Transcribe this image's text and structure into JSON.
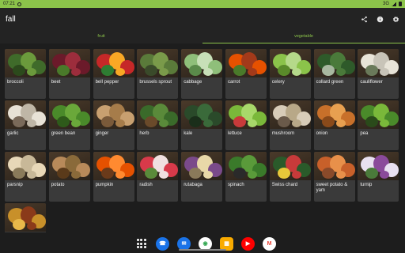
{
  "status": {
    "time": "07:21",
    "network": "3G"
  },
  "app": {
    "title": "fall"
  },
  "tabs": [
    {
      "label": "fruit",
      "active": false
    },
    {
      "label": "vegetable",
      "active": true
    }
  ],
  "colors": {
    "accent": "#8bc34a",
    "card": "#3a3a3a",
    "background": "#1d1d1d"
  },
  "items": [
    {
      "label": "broccoli",
      "colors": [
        "#3f6b2a",
        "#6b9a3c",
        "#2c4a1c"
      ]
    },
    {
      "label": "beet",
      "colors": [
        "#6b1a2a",
        "#9c2d3c",
        "#4a7a2a"
      ]
    },
    {
      "label": "bell pepper",
      "colors": [
        "#c62828",
        "#f9a825",
        "#2e7d32"
      ]
    },
    {
      "label": "brussels sprout",
      "colors": [
        "#5a7a3a",
        "#7a9a4a",
        "#3a4a2a"
      ]
    },
    {
      "label": "cabbage",
      "colors": [
        "#8fbf7a",
        "#c8e0b8",
        "#5a8a4a"
      ]
    },
    {
      "label": "carrot",
      "colors": [
        "#e65100",
        "#a33a1a",
        "#4a7a2a"
      ]
    },
    {
      "label": "celery",
      "colors": [
        "#8bc34a",
        "#b5d98a",
        "#5a8a2a"
      ]
    },
    {
      "label": "collard green",
      "colors": [
        "#2e5a2a",
        "#4a7a3a",
        "#a8b8a0"
      ]
    },
    {
      "label": "cauliflower",
      "colors": [
        "#e8e4d8",
        "#c8c4b8",
        "#6a7a5a"
      ]
    },
    {
      "label": "garlic",
      "colors": [
        "#e8e2d6",
        "#bfb6a6",
        "#7a6a5a"
      ]
    },
    {
      "label": "green bean",
      "colors": [
        "#4a8a2a",
        "#6aa83a",
        "#2e5a1a"
      ]
    },
    {
      "label": "ginger",
      "colors": [
        "#c8a070",
        "#a67c4a",
        "#7a5a3a"
      ]
    },
    {
      "label": "herb",
      "colors": [
        "#3a6a2a",
        "#5a8a3a",
        "#6a4a2a"
      ]
    },
    {
      "label": "kale",
      "colors": [
        "#2a4a2a",
        "#3a6a3a",
        "#1a2e1a"
      ]
    },
    {
      "label": "lettuce",
      "colors": [
        "#7ab83a",
        "#a8d86a",
        "#c83a3a"
      ]
    },
    {
      "label": "mushroom",
      "colors": [
        "#d8ccb8",
        "#b8a888",
        "#6a5a4a"
      ]
    },
    {
      "label": "onion",
      "colors": [
        "#c8702a",
        "#e8a050",
        "#8a4a1a"
      ]
    },
    {
      "label": "pea",
      "colors": [
        "#4a8a2a",
        "#7ab83a",
        "#2a4a1a"
      ]
    },
    {
      "label": "parsnip",
      "colors": [
        "#e8d8b8",
        "#c8b898",
        "#8a7a5a"
      ]
    },
    {
      "label": "potato",
      "colors": [
        "#b88a5a",
        "#8a6a3a",
        "#5a3a1a"
      ]
    },
    {
      "label": "pumpkin",
      "colors": [
        "#e65100",
        "#ff8a30",
        "#6a3a1a"
      ]
    },
    {
      "label": "radish",
      "colors": [
        "#d83a4a",
        "#f0e0e0",
        "#5a8a3a"
      ]
    },
    {
      "label": "rutabaga",
      "colors": [
        "#7a4a8a",
        "#e8d8a8",
        "#8a7a5a"
      ]
    },
    {
      "label": "spinach",
      "colors": [
        "#3a7a2a",
        "#5a9a3a",
        "#2a2a2a"
      ]
    },
    {
      "label": "Swiss chard",
      "colors": [
        "#2a5a2a",
        "#c83a3a",
        "#e8c83a"
      ]
    },
    {
      "label": "sweet potato & yam",
      "colors": [
        "#c8602a",
        "#e8904a",
        "#8a4a2a"
      ]
    },
    {
      "label": "turnip",
      "colors": [
        "#e8e0f0",
        "#8a4a9a",
        "#4a7a3a"
      ]
    },
    {
      "label": "",
      "colors": [
        "#c8902a",
        "#8a3a1a",
        "#e8b84a"
      ]
    }
  ],
  "dock": [
    {
      "name": "apps"
    },
    {
      "name": "phone",
      "glyph": "☎",
      "color": "#1a73e8"
    },
    {
      "name": "messages",
      "glyph": "✉",
      "color": "#1a73e8"
    },
    {
      "name": "chrome",
      "glyph": "◉",
      "color": "#34a853"
    },
    {
      "name": "calculator",
      "glyph": "▦",
      "color": "#f9ab00"
    },
    {
      "name": "youtube",
      "glyph": "▶",
      "color": "#ff0000"
    },
    {
      "name": "gmail",
      "glyph": "M",
      "color": "#ea4335"
    }
  ]
}
